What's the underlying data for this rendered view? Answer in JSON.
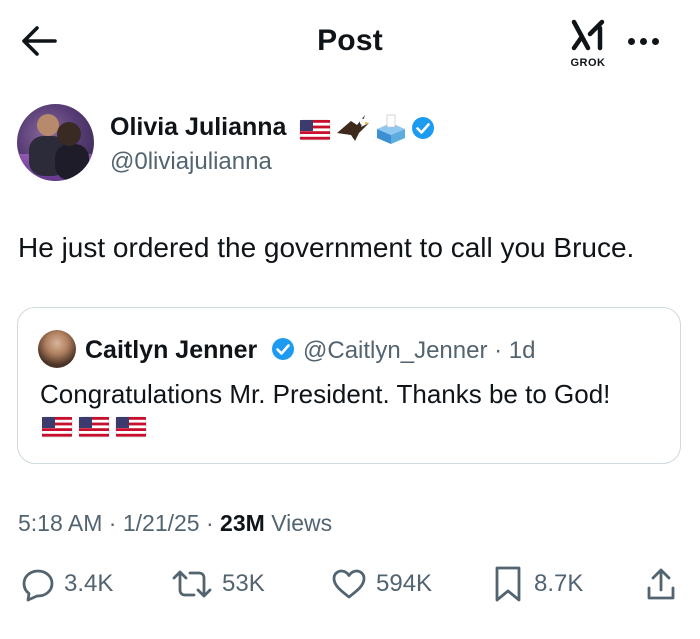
{
  "header": {
    "title": "Post",
    "grok_label": "GROK",
    "icons": [
      "back-arrow-icon",
      "grok-icon",
      "more-icon"
    ]
  },
  "author": {
    "name": "Olivia Julianna",
    "handle": "@0liviajulianna",
    "name_emojis": [
      "us-flag-icon",
      "eagle-icon",
      "ballot-box-icon",
      "verified-badge-icon"
    ]
  },
  "post": {
    "text": "He just ordered the government to call you Bruce."
  },
  "quoted_post": {
    "name": "Caitlyn Jenner",
    "handle": "@Caitlyn_Jenner",
    "separator": "·",
    "time": "1d",
    "text": "Congratulations Mr. President. Thanks be to God!",
    "flags": [
      "us-flag-icon",
      "us-flag-icon",
      "us-flag-icon"
    ]
  },
  "meta": {
    "time": "5:18 AM",
    "date": "1/21/25",
    "sep": "·",
    "views_count": "23M",
    "views_label": "Views"
  },
  "actions": {
    "replies": "3.4K",
    "reposts": "53K",
    "likes": "594K",
    "bookmarks": "8.7K"
  },
  "colors": {
    "text": "#0f1419",
    "secondary": "#536471",
    "verified": "#1d9bf0",
    "border": "#cfd9de"
  }
}
